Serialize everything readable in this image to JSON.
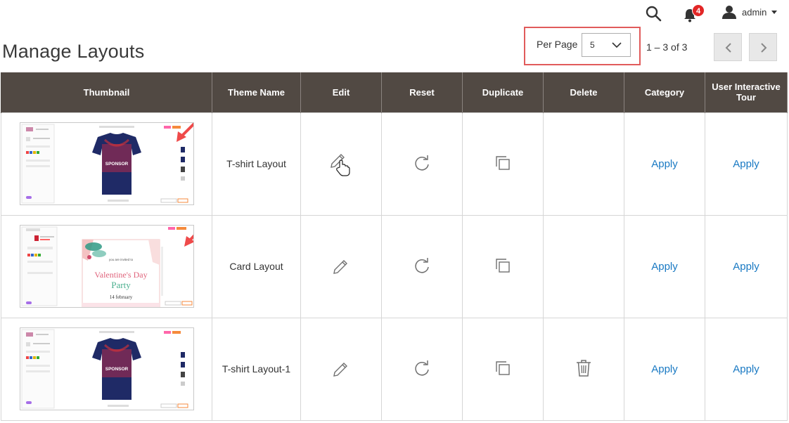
{
  "header": {
    "notification_count": "4",
    "user_name": "admin"
  },
  "page_title": "Manage Layouts",
  "pagination": {
    "per_page_label": "Per Page",
    "per_page_value": "5",
    "range_text": "1 – 3 of 3"
  },
  "table": {
    "columns": [
      "Thumbnail",
      "Theme Name",
      "Edit",
      "Reset",
      "Duplicate",
      "Delete",
      "Category",
      "User Interactive Tour"
    ],
    "rows": [
      {
        "theme_name": "T-shirt Layout",
        "category_action": "Apply",
        "tour_action": "Apply"
      },
      {
        "theme_name": "Card Layout",
        "category_action": "Apply",
        "tour_action": "Apply"
      },
      {
        "theme_name": "T-shirt Layout-1",
        "category_action": "Apply",
        "tour_action": "Apply"
      }
    ]
  },
  "thumbnail_text": {
    "sponsor": "SPONSOR",
    "card_invite": "you are invited to",
    "card_title": "Valentine's Day",
    "card_party": "Party",
    "card_date": "14 february"
  },
  "colors": {
    "header_bg": "#514943",
    "link": "#1979c3",
    "badge": "#e22626",
    "highlight_box": "#e15b5b",
    "arrow": "#ef4a4a"
  }
}
